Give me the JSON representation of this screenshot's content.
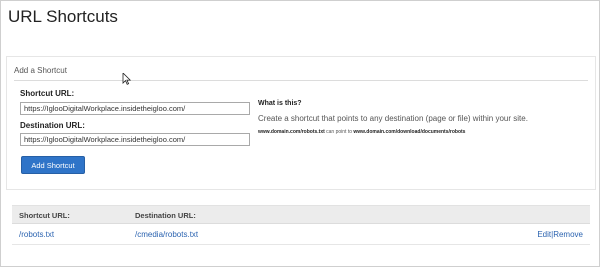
{
  "page": {
    "title": "URL Shortcuts"
  },
  "add_section": {
    "header": "Add a Shortcut",
    "shortcut_label": "Shortcut URL:",
    "shortcut_value": "https://IglooDigitalWorkplace.insidetheigloo.com/",
    "destination_label": "Destination URL:",
    "destination_value": "https://IglooDigitalWorkplace.insidetheigloo.com/",
    "submit_label": "Add Shortcut"
  },
  "help": {
    "title": "What is this?",
    "text": "Create a shortcut that points to any destination (page or file) within your site.",
    "example_source": "www.domain.com/robots.txt",
    "example_joiner": "can point to",
    "example_target": "www.domain.com/download/documents/robots"
  },
  "table": {
    "columns": [
      "Shortcut URL:",
      "Destination URL:"
    ],
    "rows": [
      {
        "shortcut": "/robots.txt",
        "destination": "/cmedia/robots.txt",
        "edit_label": "Edit",
        "separator": "|",
        "remove_label": "Remove"
      }
    ]
  },
  "colors": {
    "accent": "#2f74c8",
    "link": "#2b63b0",
    "header_bg": "#ececec"
  },
  "icons": {
    "cursor": "mouse-pointer-icon"
  }
}
